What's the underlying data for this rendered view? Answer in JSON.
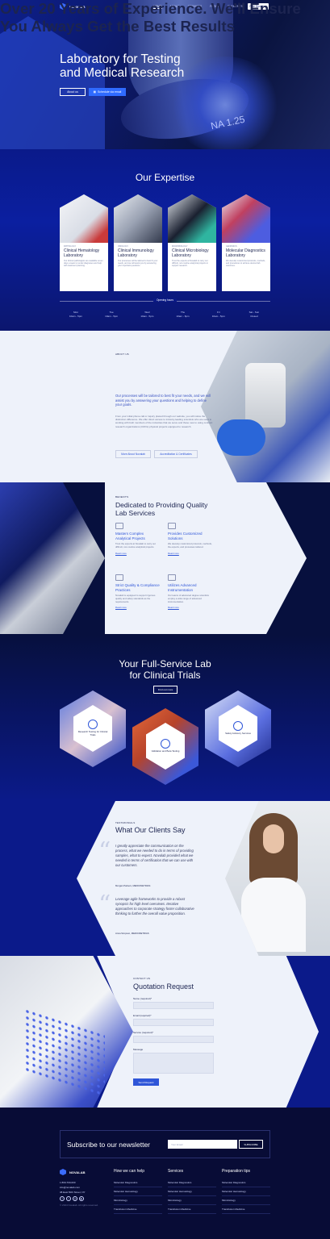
{
  "header": {
    "brand": "NOVALAB",
    "nav": [
      "HOME",
      "ABOUT",
      "SERVICES",
      "PAGES",
      "ELEMENTS"
    ],
    "cta": "Free Quotation"
  },
  "hero": {
    "title_line1": "Laboratory for Testing",
    "title_line2": "and Medical Research",
    "about_btn": "About us",
    "schedule_btn": "Schedule via email",
    "lens_text": "NA 1.25"
  },
  "expertise": {
    "title": "Our Expertise",
    "cards": [
      {
        "tag": "PATHOLOGY",
        "title": "Clinical Hematology Laboratory",
        "desc": "Our clinical pathologists are available seven days a week to render diagnoses and help with treatment planning."
      },
      {
        "tag": "VIROLOGY",
        "title": "Clinical Immunology Laboratory",
        "desc": "Our processes will be tailored to best fit your needs, and we will assist you by answering your important questions."
      },
      {
        "tag": "MICROBIOLOGY",
        "title": "Clinical Microbiology Laboratory",
        "desc": "Trust the experts at Novalab to carry out difficult, non-routine analytical projects in support research."
      },
      {
        "tag": "GENOMICS",
        "title": "Molecular Diagnostics Laboratory",
        "desc": "We develop customized protocols, methods, and procedures to achieve desired lab outcomes."
      }
    ],
    "hours_label": "Opening hours",
    "hours": [
      {
        "day": "Mon",
        "time": "10am - 5pm"
      },
      {
        "day": "Tue",
        "time": "10am - 5pm"
      },
      {
        "day": "Wed",
        "time": "10am - 5pm"
      },
      {
        "day": "Thu",
        "time": "10am - 6pm"
      },
      {
        "day": "Fri",
        "time": "10am - 5pm"
      },
      {
        "day": "Sat - Sun",
        "time": "Closed"
      }
    ]
  },
  "about": {
    "eyebrow": "ABOUT US",
    "title": "Over 20 Years of Experience. We'll Ensure You Always Get the Best Results",
    "lead": "Our processes will be tailored to best fit your needs, and we will assist you by answering your questions and helping to define your goals.",
    "body": "From your initial phone call or inquiry placed through our website, you will notice the distinction difference. We offer direct access to industry-leading scientists who are used to working with both members of the industries that we serve and those new to using contract research organizations (CROs) physical projects equipped to research.",
    "btn1": "More About Novalab",
    "btn2": "Accreditation & Certificates"
  },
  "benefits": {
    "eyebrow": "BENEFITS",
    "title": "Dedicated to Providing Quality Lab Services",
    "items": [
      {
        "title": "Masters Complex Analytical Projects",
        "body": "Trust the experts at Novalab to carry out difficult, non-routine analytical projects.",
        "more": "Read more"
      },
      {
        "title": "Provides Customized Solutions",
        "body": "We develop customized protocols, methods, the experts, and processes tailored.",
        "more": "Read more"
      },
      {
        "title": "Strict Quality & Compliance Practices",
        "body": "Novalab is equipped to support rigorous quality and safety standards as the requirements.",
        "more": "Read more"
      },
      {
        "title": "Utilizes Advanced Instrumentation",
        "body": "Our teams of advanced degree scientists employ a wide range of advanced instrumentation.",
        "more": "Read more"
      }
    ]
  },
  "fullservice": {
    "title_line1": "Your Full-Service Lab",
    "title_line2": "for Clinical Trials",
    "btn": "Find out more",
    "items": [
      "Research Testing for Clinical Trials",
      "Validation and Beta Testing",
      "Safety Advisory Services"
    ]
  },
  "testimonials": {
    "eyebrow": "TESTIMONIALS",
    "title": "What Our Clients Say",
    "quotes": [
      {
        "text": "I greatly appreciate the communication on the process, what we needed to do in terms of providing samples, what to expect. Novalab provided what we needed in terms of certification that we can use with our customers.",
        "author": "Morgan Parkers, MEDICINETRIAS"
      },
      {
        "text": "Leverage agile frameworks to provide a robust synopsis for high level overviews. Iterative approaches to corporate strategy foster collaborative thinking to further the overall value proposition.",
        "author": "Anna Simpson, MEDICINETRIAS"
      }
    ]
  },
  "quotation": {
    "eyebrow": "CONTACT US",
    "title": "Quotation Request",
    "fields": [
      "Name (required)*",
      "Email (required)*",
      "Service (required)*",
      "Message"
    ],
    "submit": "Send Request"
  },
  "newsletter": {
    "title": "Subscribe to our newsletter",
    "placeholder": "Your Email",
    "button": "SUBSCRIBE"
  },
  "footer": {
    "brand": "NOVALAB",
    "phone": "1 800-700-000",
    "email": "info@novalab.com",
    "address": "38 East 50th Street, NY",
    "copyright": "© 2024 Novalab. All rights reserved.",
    "cols": [
      {
        "title": "How we can help",
        "links": [
          "Molecular Diagnostics",
          "Molecular Hematology",
          "Microbiology",
          "Transfusion Medicine"
        ]
      },
      {
        "title": "Services",
        "links": [
          "Molecular Diagnostics",
          "Molecular Hematology",
          "Microbiology",
          "Transfusion Medicine"
        ]
      },
      {
        "title": "Preparation tips",
        "links": [
          "Molecular Diagnostics",
          "Molecular Hematology",
          "Microbiology",
          "Transfusion Medicine"
        ]
      }
    ]
  }
}
